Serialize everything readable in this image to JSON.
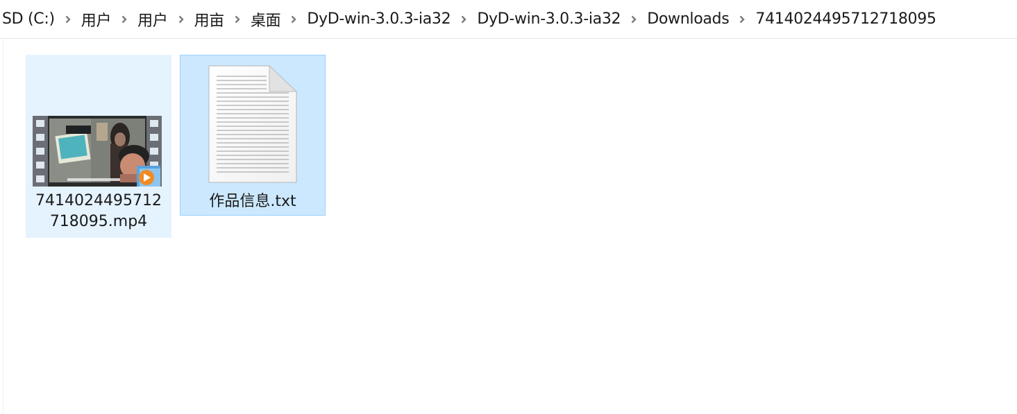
{
  "breadcrumb": {
    "items": [
      {
        "label": "SD (C:)"
      },
      {
        "label": "用户"
      },
      {
        "label": "用户"
      },
      {
        "label": "用亩"
      },
      {
        "label": "桌面"
      },
      {
        "label": "DyD-win-3.0.3-ia32"
      },
      {
        "label": "DyD-win-3.0.3-ia32"
      },
      {
        "label": "Downloads"
      },
      {
        "label": "7414024495712718095"
      }
    ],
    "separator_icon": "chevron-right-icon"
  },
  "files": [
    {
      "name": "7414024495712718095.mp4",
      "name_line1": "7414024495712",
      "name_line2": "718095.mp4",
      "type": "video",
      "icon": "video-thumbnail-icon",
      "state": "hover"
    },
    {
      "name": "作品信息.txt",
      "type": "text",
      "icon": "text-document-icon",
      "state": "selected"
    }
  ],
  "colors": {
    "hover_bg": "#e5f3ff",
    "selected_bg": "#cce8ff",
    "selected_border": "#99d1ff",
    "chevron": "#7a7a7a"
  }
}
